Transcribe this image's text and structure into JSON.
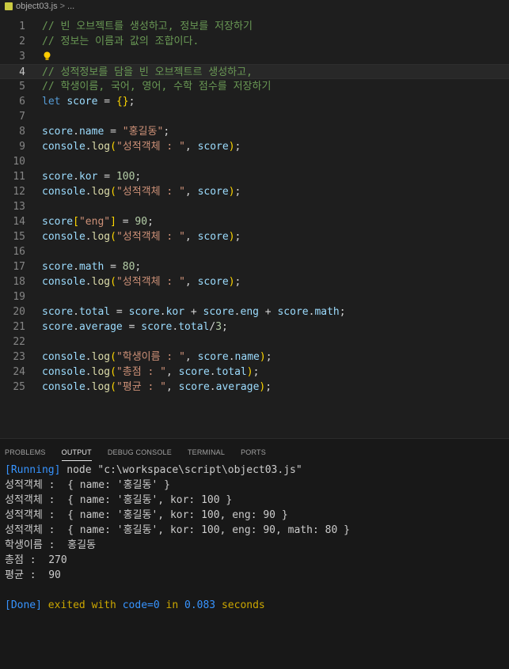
{
  "breadcrumb": {
    "file": "object03.js",
    "separator": ">",
    "rest": "..."
  },
  "editor": {
    "lines": [
      {
        "n": "1",
        "tokens": [
          {
            "c": "cmt",
            "t": "// 빈 오브젝트를 생성하고, 정보를 저장하기"
          }
        ]
      },
      {
        "n": "2",
        "tokens": [
          {
            "c": "cmt",
            "t": "// 정보는 이름과 값의 조합이다."
          }
        ]
      },
      {
        "n": "3",
        "tokens": []
      },
      {
        "n": "4",
        "tokens": [
          {
            "c": "cmt",
            "t": "// 성적정보를 담을 빈 오브젝트르 생성하고,"
          }
        ]
      },
      {
        "n": "5",
        "tokens": [
          {
            "c": "cmt",
            "t": "// 학생이름, 국어, 영어, 수학 점수를 저장하기"
          }
        ]
      },
      {
        "n": "6",
        "tokens": [
          {
            "c": "kw",
            "t": "let"
          },
          {
            "c": "pl",
            "t": " "
          },
          {
            "c": "var",
            "t": "score"
          },
          {
            "c": "pl",
            "t": " = "
          },
          {
            "c": "brk",
            "t": "{}"
          },
          {
            "c": "pl",
            "t": ";"
          }
        ]
      },
      {
        "n": "7",
        "tokens": []
      },
      {
        "n": "8",
        "tokens": [
          {
            "c": "var",
            "t": "score"
          },
          {
            "c": "pl",
            "t": "."
          },
          {
            "c": "var",
            "t": "name"
          },
          {
            "c": "pl",
            "t": " = "
          },
          {
            "c": "str",
            "t": "\"홍길동\""
          },
          {
            "c": "pl",
            "t": ";"
          }
        ]
      },
      {
        "n": "9",
        "tokens": [
          {
            "c": "var",
            "t": "console"
          },
          {
            "c": "pl",
            "t": "."
          },
          {
            "c": "fn",
            "t": "log"
          },
          {
            "c": "brk",
            "t": "("
          },
          {
            "c": "str",
            "t": "\"성적객체 : \""
          },
          {
            "c": "pl",
            "t": ", "
          },
          {
            "c": "var",
            "t": "score"
          },
          {
            "c": "brk",
            "t": ")"
          },
          {
            "c": "pl",
            "t": ";"
          }
        ]
      },
      {
        "n": "10",
        "tokens": []
      },
      {
        "n": "11",
        "tokens": [
          {
            "c": "var",
            "t": "score"
          },
          {
            "c": "pl",
            "t": "."
          },
          {
            "c": "var",
            "t": "kor"
          },
          {
            "c": "pl",
            "t": " = "
          },
          {
            "c": "num",
            "t": "100"
          },
          {
            "c": "pl",
            "t": ";"
          }
        ]
      },
      {
        "n": "12",
        "tokens": [
          {
            "c": "var",
            "t": "console"
          },
          {
            "c": "pl",
            "t": "."
          },
          {
            "c": "fn",
            "t": "log"
          },
          {
            "c": "brk",
            "t": "("
          },
          {
            "c": "str",
            "t": "\"성적객체 : \""
          },
          {
            "c": "pl",
            "t": ", "
          },
          {
            "c": "var",
            "t": "score"
          },
          {
            "c": "brk",
            "t": ")"
          },
          {
            "c": "pl",
            "t": ";"
          }
        ]
      },
      {
        "n": "13",
        "tokens": []
      },
      {
        "n": "14",
        "tokens": [
          {
            "c": "var",
            "t": "score"
          },
          {
            "c": "brk",
            "t": "["
          },
          {
            "c": "str",
            "t": "\"eng\""
          },
          {
            "c": "brk",
            "t": "]"
          },
          {
            "c": "pl",
            "t": " = "
          },
          {
            "c": "num",
            "t": "90"
          },
          {
            "c": "pl",
            "t": ";"
          }
        ]
      },
      {
        "n": "15",
        "tokens": [
          {
            "c": "var",
            "t": "console"
          },
          {
            "c": "pl",
            "t": "."
          },
          {
            "c": "fn",
            "t": "log"
          },
          {
            "c": "brk",
            "t": "("
          },
          {
            "c": "str",
            "t": "\"성적객체 : \""
          },
          {
            "c": "pl",
            "t": ", "
          },
          {
            "c": "var",
            "t": "score"
          },
          {
            "c": "brk",
            "t": ")"
          },
          {
            "c": "pl",
            "t": ";"
          }
        ]
      },
      {
        "n": "16",
        "tokens": []
      },
      {
        "n": "17",
        "tokens": [
          {
            "c": "var",
            "t": "score"
          },
          {
            "c": "pl",
            "t": "."
          },
          {
            "c": "var",
            "t": "math"
          },
          {
            "c": "pl",
            "t": " = "
          },
          {
            "c": "num",
            "t": "80"
          },
          {
            "c": "pl",
            "t": ";"
          }
        ]
      },
      {
        "n": "18",
        "tokens": [
          {
            "c": "var",
            "t": "console"
          },
          {
            "c": "pl",
            "t": "."
          },
          {
            "c": "fn",
            "t": "log"
          },
          {
            "c": "brk",
            "t": "("
          },
          {
            "c": "str",
            "t": "\"성적객체 : \""
          },
          {
            "c": "pl",
            "t": ", "
          },
          {
            "c": "var",
            "t": "score"
          },
          {
            "c": "brk",
            "t": ")"
          },
          {
            "c": "pl",
            "t": ";"
          }
        ]
      },
      {
        "n": "19",
        "tokens": []
      },
      {
        "n": "20",
        "tokens": [
          {
            "c": "var",
            "t": "score"
          },
          {
            "c": "pl",
            "t": "."
          },
          {
            "c": "var",
            "t": "total"
          },
          {
            "c": "pl",
            "t": " = "
          },
          {
            "c": "var",
            "t": "score"
          },
          {
            "c": "pl",
            "t": "."
          },
          {
            "c": "var",
            "t": "kor"
          },
          {
            "c": "pl",
            "t": " + "
          },
          {
            "c": "var",
            "t": "score"
          },
          {
            "c": "pl",
            "t": "."
          },
          {
            "c": "var",
            "t": "eng"
          },
          {
            "c": "pl",
            "t": " + "
          },
          {
            "c": "var",
            "t": "score"
          },
          {
            "c": "pl",
            "t": "."
          },
          {
            "c": "var",
            "t": "math"
          },
          {
            "c": "pl",
            "t": ";"
          }
        ]
      },
      {
        "n": "21",
        "tokens": [
          {
            "c": "var",
            "t": "score"
          },
          {
            "c": "pl",
            "t": "."
          },
          {
            "c": "var",
            "t": "average"
          },
          {
            "c": "pl",
            "t": " = "
          },
          {
            "c": "var",
            "t": "score"
          },
          {
            "c": "pl",
            "t": "."
          },
          {
            "c": "var",
            "t": "total"
          },
          {
            "c": "pl",
            "t": "/"
          },
          {
            "c": "num",
            "t": "3"
          },
          {
            "c": "pl",
            "t": ";"
          }
        ]
      },
      {
        "n": "22",
        "tokens": []
      },
      {
        "n": "23",
        "tokens": [
          {
            "c": "var",
            "t": "console"
          },
          {
            "c": "pl",
            "t": "."
          },
          {
            "c": "fn",
            "t": "log"
          },
          {
            "c": "brk",
            "t": "("
          },
          {
            "c": "str",
            "t": "\"학생이름 : \""
          },
          {
            "c": "pl",
            "t": ", "
          },
          {
            "c": "var",
            "t": "score"
          },
          {
            "c": "pl",
            "t": "."
          },
          {
            "c": "var",
            "t": "name"
          },
          {
            "c": "brk",
            "t": ")"
          },
          {
            "c": "pl",
            "t": ";"
          }
        ]
      },
      {
        "n": "24",
        "tokens": [
          {
            "c": "var",
            "t": "console"
          },
          {
            "c": "pl",
            "t": "."
          },
          {
            "c": "fn",
            "t": "log"
          },
          {
            "c": "brk",
            "t": "("
          },
          {
            "c": "str",
            "t": "\"총점 : \""
          },
          {
            "c": "pl",
            "t": ", "
          },
          {
            "c": "var",
            "t": "score"
          },
          {
            "c": "pl",
            "t": "."
          },
          {
            "c": "var",
            "t": "total"
          },
          {
            "c": "brk",
            "t": ")"
          },
          {
            "c": "pl",
            "t": ";"
          }
        ]
      },
      {
        "n": "25",
        "tokens": [
          {
            "c": "var",
            "t": "console"
          },
          {
            "c": "pl",
            "t": "."
          },
          {
            "c": "fn",
            "t": "log"
          },
          {
            "c": "brk",
            "t": "("
          },
          {
            "c": "str",
            "t": "\"평균 : \""
          },
          {
            "c": "pl",
            "t": ", "
          },
          {
            "c": "var",
            "t": "score"
          },
          {
            "c": "pl",
            "t": "."
          },
          {
            "c": "var",
            "t": "average"
          },
          {
            "c": "brk",
            "t": ")"
          },
          {
            "c": "pl",
            "t": ";"
          }
        ]
      }
    ],
    "active_line": "4",
    "lightbulb_line": "3",
    "lightbulb_icon": "lightbulb-icon"
  },
  "panel": {
    "tabs": [
      {
        "label": "PROBLEMS",
        "active": false
      },
      {
        "label": "OUTPUT",
        "active": true
      },
      {
        "label": "DEBUG CONSOLE",
        "active": false
      },
      {
        "label": "TERMINAL",
        "active": false
      },
      {
        "label": "PORTS",
        "active": false
      }
    ],
    "output": [
      [
        {
          "c": "o-blue",
          "t": "[Running]"
        },
        {
          "c": "",
          "t": " node \"c:\\workspace\\script\\object03.js\""
        }
      ],
      [
        {
          "c": "",
          "t": "성적객체 :  { name: '홍길동' }"
        }
      ],
      [
        {
          "c": "",
          "t": "성적객체 :  { name: '홍길동', kor: 100 }"
        }
      ],
      [
        {
          "c": "",
          "t": "성적객체 :  { name: '홍길동', kor: 100, eng: 90 }"
        }
      ],
      [
        {
          "c": "",
          "t": "성적객체 :  { name: '홍길동', kor: 100, eng: 90, math: 80 }"
        }
      ],
      [
        {
          "c": "",
          "t": "학생이름 :  홍길동"
        }
      ],
      [
        {
          "c": "",
          "t": "총점 :  270"
        }
      ],
      [
        {
          "c": "",
          "t": "평균 :  90"
        }
      ],
      [],
      [
        {
          "c": "o-blue",
          "t": "[Done]"
        },
        {
          "c": "o-yellow",
          "t": " exited with "
        },
        {
          "c": "o-blue",
          "t": "code=0"
        },
        {
          "c": "o-yellow",
          "t": " in "
        },
        {
          "c": "o-blue",
          "t": "0.083"
        },
        {
          "c": "o-yellow",
          "t": " seconds"
        }
      ]
    ]
  },
  "colors": {
    "background": "#1e1e1e",
    "panel_background": "#181818",
    "comment": "#6a9955",
    "keyword": "#569cd6",
    "variable": "#9cdcfe",
    "function": "#dcdcaa",
    "string": "#ce9178",
    "number": "#b5cea8",
    "bracket": "#ffd700"
  }
}
